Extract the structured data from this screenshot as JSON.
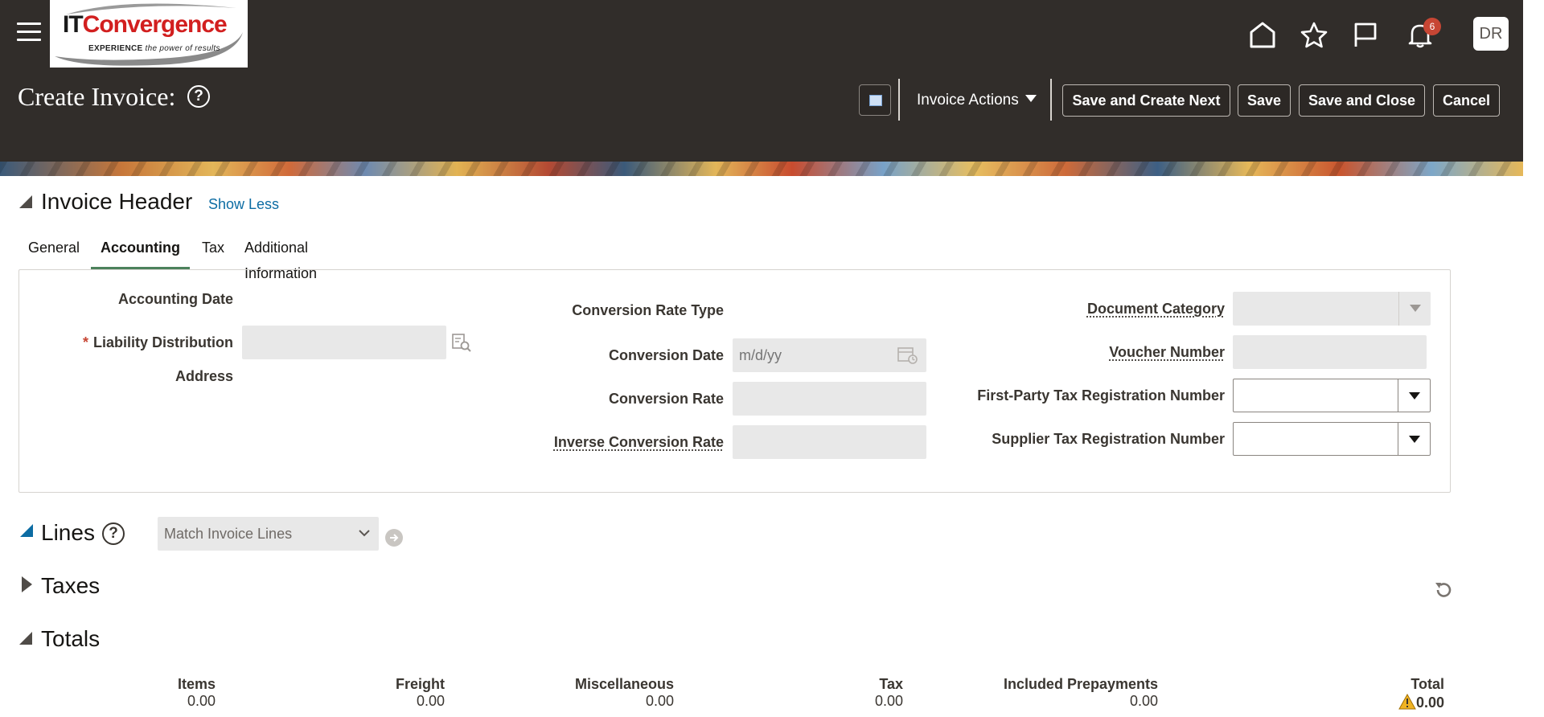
{
  "header": {
    "logo": {
      "it": "IT",
      "conv": "Convergence",
      "tag_bold": "EXPERIENCE",
      "tag_rest": " the power of results"
    },
    "notification_count": "6",
    "avatar_initials": "DR",
    "page_title": "Create Invoice:",
    "help_glyph": "?",
    "invoice_actions_label": "Invoice Actions",
    "buttons": {
      "save_and_create_next": "Save and Create Next",
      "save": "Save",
      "save_and_close": "Save and Close",
      "cancel": "Cancel"
    }
  },
  "invoice_header": {
    "title": "Invoice Header",
    "show_less": "Show Less",
    "tabs": [
      {
        "label": "General"
      },
      {
        "label": "Accounting",
        "active": true
      },
      {
        "label": "Tax"
      },
      {
        "label": "Additional Information"
      }
    ],
    "fields": {
      "accounting_date": {
        "label": "Accounting Date"
      },
      "liability_distribution": {
        "label": "Liability Distribution",
        "required": "*"
      },
      "address": {
        "label": "Address"
      },
      "conversion_rate_type": {
        "label": "Conversion Rate Type"
      },
      "conversion_date": {
        "label": "Conversion Date",
        "placeholder": "m/d/yy"
      },
      "conversion_rate": {
        "label": "Conversion Rate"
      },
      "inverse_conversion_rate": {
        "label": "Inverse Conversion Rate"
      },
      "document_category": {
        "label": "Document Category"
      },
      "voucher_number": {
        "label": "Voucher Number"
      },
      "first_party_tax_reg": {
        "label": "First-Party Tax Registration Number"
      },
      "supplier_tax_reg": {
        "label": "Supplier Tax Registration Number"
      }
    }
  },
  "lines": {
    "title": "Lines",
    "help_glyph": "?",
    "match_select": "Match Invoice Lines"
  },
  "taxes": {
    "title": "Taxes"
  },
  "totals": {
    "title": "Totals",
    "items": [
      {
        "label": "Items",
        "value": "0.00"
      },
      {
        "label": "Freight",
        "value": "0.00"
      },
      {
        "label": "Miscellaneous",
        "value": "0.00"
      },
      {
        "label": "Tax",
        "value": "0.00"
      },
      {
        "label": "Included Prepayments",
        "value": "0.00"
      },
      {
        "label": "Total",
        "value": "0.00"
      }
    ]
  },
  "colors": {
    "header_bg": "#312d2a",
    "accent_green": "#4c825c",
    "link": "#0c6ca3",
    "badge": "#c74634"
  },
  "icons": [
    "hamburger-icon",
    "home-icon",
    "star-icon",
    "flag-icon",
    "bell-icon",
    "help-icon",
    "search-icon",
    "calendar-icon",
    "refresh-icon",
    "warning-icon"
  ]
}
